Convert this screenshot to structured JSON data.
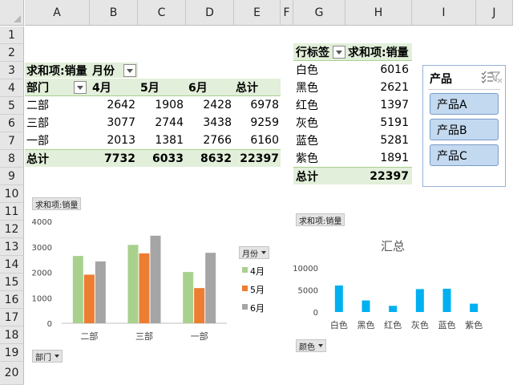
{
  "columns": [
    "A",
    "B",
    "C",
    "D",
    "E",
    "F",
    "G",
    "H",
    "I",
    "J"
  ],
  "rows": [
    "1",
    "2",
    "3",
    "4",
    "5",
    "6",
    "7",
    "8",
    "9",
    "10",
    "11",
    "12",
    "13",
    "14",
    "15",
    "16",
    "17",
    "18",
    "19",
    "20"
  ],
  "pivot1": {
    "filter_label": "求和项:销量",
    "col_field": "月份",
    "row_field": "部门",
    "months": [
      "4月",
      "5月",
      "6月"
    ],
    "total_label": "总计",
    "rows": [
      {
        "name": "二部",
        "values": [
          "2642",
          "1908",
          "2428"
        ],
        "total": "6978"
      },
      {
        "name": "三部",
        "values": [
          "3077",
          "2744",
          "3438"
        ],
        "total": "9259"
      },
      {
        "name": "一部",
        "values": [
          "2013",
          "1381",
          "2766"
        ],
        "total": "6160"
      }
    ],
    "grand_label": "总计",
    "grand": [
      "7732",
      "6033",
      "8632",
      "22397"
    ]
  },
  "pivot2": {
    "row_label": "行标签",
    "value_label": "求和项:销量",
    "rows": [
      {
        "name": "白色",
        "value": "6016"
      },
      {
        "name": "黑色",
        "value": "2621"
      },
      {
        "name": "红色",
        "value": "1397"
      },
      {
        "name": "灰色",
        "value": "5191"
      },
      {
        "name": "蓝色",
        "value": "5281"
      },
      {
        "name": "紫色",
        "value": "1891"
      }
    ],
    "grand_label": "总计",
    "grand": "22397"
  },
  "slicer": {
    "title": "产品",
    "items": [
      "产品A",
      "产品B",
      "产品C"
    ]
  },
  "chart1_buttons": {
    "value": "求和项:销量",
    "legend": "月份",
    "axis": "部门"
  },
  "chart2_buttons": {
    "value": "求和项:销量",
    "axis": "颜色"
  },
  "colors": {
    "series_4": "#a9d18e",
    "series_5": "#ed7d31",
    "series_6": "#a5a5a5",
    "bar2": "#00b0f0",
    "header_fill": "#e2efda"
  },
  "chart_data": [
    {
      "type": "bar",
      "categories": [
        "二部",
        "三部",
        "一部"
      ],
      "series": [
        {
          "name": "4月",
          "values": [
            2642,
            3077,
            2013
          ]
        },
        {
          "name": "5月",
          "values": [
            1908,
            2744,
            1381
          ]
        },
        {
          "name": "6月",
          "values": [
            2428,
            3438,
            2766
          ]
        }
      ],
      "yticks": [
        "0",
        "1000",
        "2000",
        "3000",
        "4000"
      ],
      "ylim": [
        0,
        4000
      ],
      "legend": "right"
    },
    {
      "type": "bar",
      "title": "汇总",
      "categories": [
        "白色",
        "黑色",
        "红色",
        "灰色",
        "蓝色",
        "紫色"
      ],
      "values": [
        6016,
        2621,
        1397,
        5191,
        5281,
        1891
      ],
      "yticks": [
        "0",
        "5000",
        "10000"
      ],
      "ylim": [
        0,
        10000
      ]
    }
  ]
}
